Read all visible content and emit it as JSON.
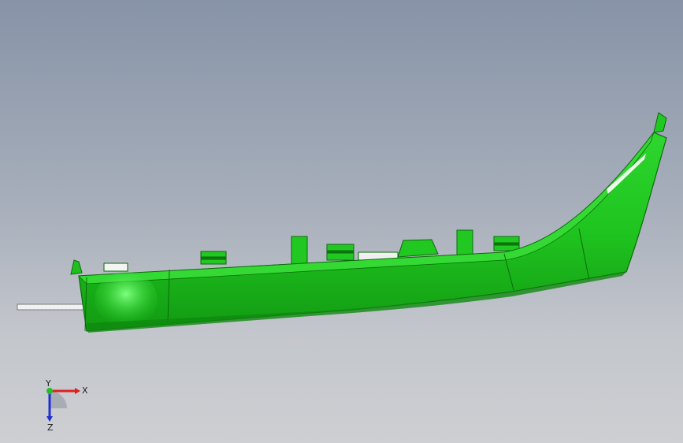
{
  "viewport": {
    "model_color": "#22cc22",
    "background_top": "#8793a7",
    "background_bottom": "#cdcfd2"
  },
  "triad": {
    "x_label": "X",
    "y_label": "Y",
    "z_label": "Z",
    "x_color": "#e02020",
    "y_color": "#22c022",
    "z_color": "#2030d0"
  }
}
